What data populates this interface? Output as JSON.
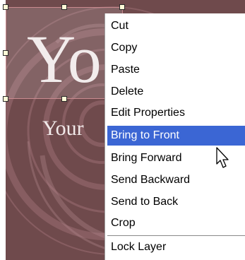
{
  "canvas": {
    "bg_color": "#6f4a4c",
    "selected_text": "Yo",
    "subtitle_text": "Your"
  },
  "context_menu": {
    "items": [
      {
        "label": "Cut"
      },
      {
        "label": "Copy"
      },
      {
        "label": "Paste"
      },
      {
        "label": "Delete"
      },
      {
        "label": "Edit Properties"
      },
      {
        "label": "Bring to Front",
        "highlighted": true
      },
      {
        "label": "Bring Forward"
      },
      {
        "label": "Send Backward"
      },
      {
        "label": "Send to Back"
      },
      {
        "label": "Crop"
      },
      {
        "label": "Lock Layer"
      }
    ],
    "highlight_color": "#3b66d4"
  },
  "icons": {
    "cursor": "arrow-cursor-icon",
    "handle": "resize-handle-icon"
  }
}
